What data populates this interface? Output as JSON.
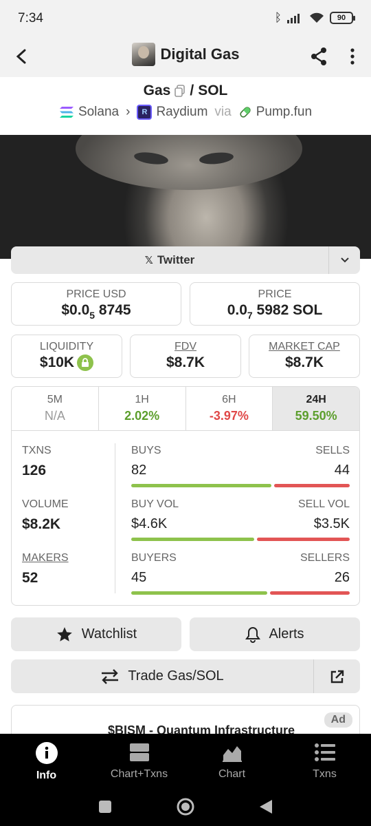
{
  "status": {
    "time": "7:34",
    "battery": "90"
  },
  "header": {
    "title": "Digital Gas"
  },
  "pair": {
    "base": "Gas",
    "quote": "SOL",
    "chain": "Solana",
    "dex": "Raydium",
    "via_label": "via",
    "launchpad": "Pump.fun"
  },
  "links": {
    "twitter_label": "Twitter"
  },
  "price": {
    "usd_label": "PRICE USD",
    "usd_prefix": "$0.0",
    "usd_sub": "5",
    "usd_rest": "8745",
    "native_label": "PRICE",
    "native_prefix": "0.0",
    "native_sub": "7",
    "native_rest": "5982 SOL"
  },
  "metrics_top": {
    "liquidity_label": "LIQUIDITY",
    "liquidity": "$10K",
    "fdv_label": "FDV",
    "fdv": "$8.7K",
    "mcap_label": "MARKET CAP",
    "mcap": "$8.7K"
  },
  "timeframes": [
    {
      "name": "5M",
      "change": "N/A"
    },
    {
      "name": "1H",
      "change": "2.02%"
    },
    {
      "name": "6H",
      "change": "-3.97%"
    },
    {
      "name": "24H",
      "change": "59.50%"
    }
  ],
  "stats": {
    "txns_label": "TXNS",
    "txns": "126",
    "volume_label": "VOLUME",
    "volume": "$8.2K",
    "makers_label": "MAKERS",
    "makers": "52",
    "buys_label": "BUYS",
    "buys": "82",
    "sells_label": "SELLS",
    "sells": "44",
    "buyvol_label": "BUY VOL",
    "buyvol": "$4.6K",
    "sellvol_label": "SELL VOL",
    "sellvol": "$3.5K",
    "buyers_label": "BUYERS",
    "buyers": "45",
    "sellers_label": "SELLERS",
    "sellers": "26",
    "buy_share": 0.65,
    "buyvol_share": 0.57,
    "buyers_share": 0.63
  },
  "actions": {
    "watchlist": "Watchlist",
    "alerts": "Alerts",
    "trade": "Trade Gas/SOL"
  },
  "ad": {
    "title": "$BISM - Quantum Infrastructure",
    "badge": "Ad"
  },
  "nav": {
    "info": "Info",
    "chart_txns": "Chart+Txns",
    "chart": "Chart",
    "txns": "Txns"
  },
  "colors": {
    "green": "#5c9e2c",
    "red": "#e04848",
    "bar_green": "#8ec24c",
    "bar_red": "#e25555"
  }
}
